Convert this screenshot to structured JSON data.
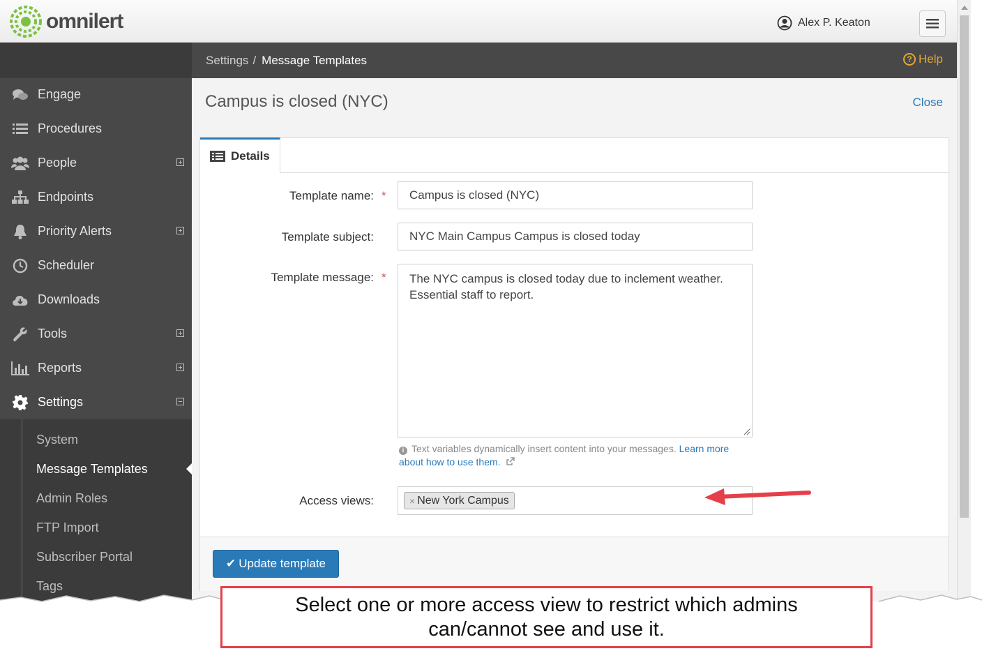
{
  "app": {
    "brand": "omnilert"
  },
  "header": {
    "user_name": "Alex P. Keaton"
  },
  "breadcrumb": {
    "parent": "Settings",
    "separator": "/",
    "current": "Message Templates",
    "help": "Help"
  },
  "page": {
    "title": "Campus is closed (NYC)",
    "close": "Close"
  },
  "sidebar": {
    "items": [
      {
        "label": "Engage",
        "icon": "chat-bubbles-icon",
        "expand": ""
      },
      {
        "label": "Procedures",
        "icon": "list-icon",
        "expand": ""
      },
      {
        "label": "People",
        "icon": "people-icon",
        "expand": "plus"
      },
      {
        "label": "Endpoints",
        "icon": "sitemap-icon",
        "expand": ""
      },
      {
        "label": "Priority Alerts",
        "icon": "bell-icon",
        "expand": "plus"
      },
      {
        "label": "Scheduler",
        "icon": "clock-icon",
        "expand": ""
      },
      {
        "label": "Downloads",
        "icon": "cloud-download-icon",
        "expand": ""
      },
      {
        "label": "Tools",
        "icon": "wrench-icon",
        "expand": "plus"
      },
      {
        "label": "Reports",
        "icon": "bar-chart-icon",
        "expand": "plus"
      },
      {
        "label": "Settings",
        "icon": "gear-icon",
        "expand": "minus"
      }
    ],
    "settings_sub": [
      "System",
      "Message Templates",
      "Admin Roles",
      "FTP Import",
      "Subscriber Portal",
      "Tags"
    ]
  },
  "tabs": {
    "details": "Details"
  },
  "form": {
    "name_label": "Template name:",
    "name_value": "Campus is closed (NYC)",
    "subject_label": "Template subject:",
    "subject_value": "NYC Main Campus Campus is closed today",
    "message_label": "Template message:",
    "message_value": "The NYC campus is closed today due to inclement weather. Essential staff to report.",
    "required_mark": "*",
    "hint_text": "Text variables dynamically insert content into your messages.",
    "hint_link": "Learn more about how to use them.",
    "access_label": "Access views:",
    "access_tag": "New York Campus",
    "access_tag_remove": "×",
    "update_button": "Update template"
  },
  "callout": {
    "text": "Select one or more access view to restrict which admins can/cannot see and use it."
  },
  "colors": {
    "accent": "#2a7ab8",
    "sidebar": "#484848",
    "help": "#e3a72f",
    "callout_border": "#e5404a",
    "required": "#d9534f"
  }
}
